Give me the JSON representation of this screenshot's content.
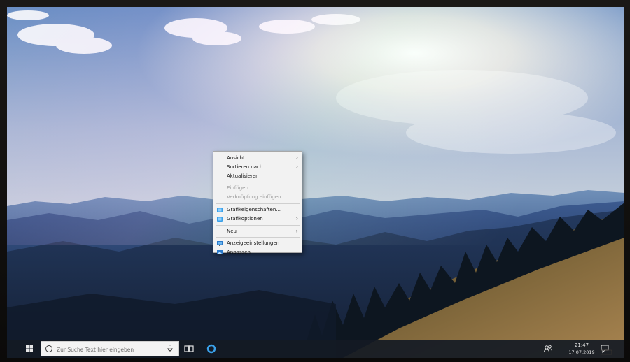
{
  "desktop": {
    "context_menu": {
      "items": [
        {
          "label": "Ansicht",
          "submenu": true,
          "disabled": false,
          "icon": ""
        },
        {
          "label": "Sortieren nach",
          "submenu": true,
          "disabled": false,
          "icon": ""
        },
        {
          "label": "Aktualisieren",
          "submenu": false,
          "disabled": false,
          "icon": ""
        },
        {
          "label": "Einfügen",
          "submenu": false,
          "disabled": true,
          "icon": ""
        },
        {
          "label": "Verknüpfung einfügen",
          "submenu": false,
          "disabled": true,
          "icon": ""
        },
        {
          "label": "Grafikeigenschaften...",
          "submenu": false,
          "disabled": false,
          "icon": "intel-graphics-icon"
        },
        {
          "label": "Grafikoptionen",
          "submenu": true,
          "disabled": false,
          "icon": "intel-graphics-icon"
        },
        {
          "label": "Neu",
          "submenu": true,
          "disabled": false,
          "icon": ""
        },
        {
          "label": "Anzeigeeinstellungen",
          "submenu": false,
          "disabled": false,
          "icon": "display-settings-icon"
        },
        {
          "label": "Anpassen",
          "submenu": false,
          "disabled": false,
          "icon": "personalize-icon"
        }
      ]
    }
  },
  "taskbar": {
    "search_placeholder": "Zur Suche Text hier eingeben",
    "clock_time": "21:47",
    "clock_date": "17.07.2019",
    "icons": {
      "start": "windows-start-icon",
      "search": "cortana-ring-icon",
      "mic": "microphone-icon",
      "taskview": "task-view-icon",
      "cortana": "cortana-icon",
      "people": "people-icon",
      "notification": "action-center-icon"
    }
  },
  "colors": {
    "menu_bg": "#f2f2f2",
    "menu_text": "#111111",
    "menu_disabled": "#9c9c9c",
    "taskbar_bg": "#141a24",
    "accent": "#3aa0e8"
  }
}
